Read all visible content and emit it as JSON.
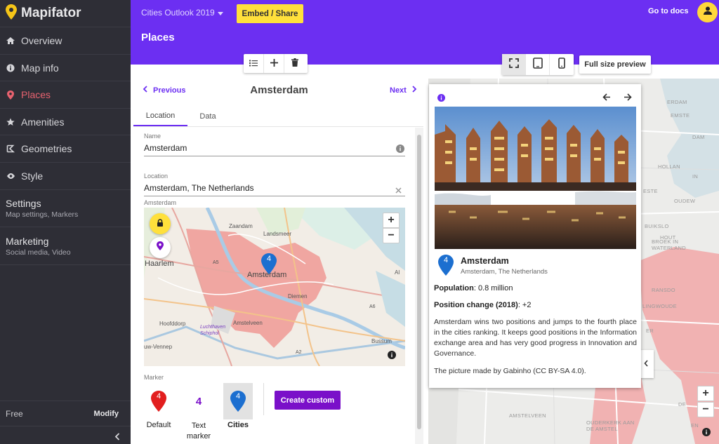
{
  "sidebar": {
    "brand": "Mapifator",
    "items": [
      {
        "label": "Overview",
        "icon": "home-icon"
      },
      {
        "label": "Map info",
        "icon": "info-icon"
      },
      {
        "label": "Places",
        "icon": "map-pin-icon",
        "active": true
      },
      {
        "label": "Amenities",
        "icon": "star-icon"
      },
      {
        "label": "Geometries",
        "icon": "geometry-icon"
      },
      {
        "label": "Style",
        "icon": "eye-icon"
      }
    ],
    "settings": {
      "title": "Settings",
      "subtitle": "Map settings, Markers"
    },
    "marketing": {
      "title": "Marketing",
      "subtitle": "Social media, Video"
    },
    "plan": "Free",
    "modify": "Modify"
  },
  "header": {
    "project": "Cities Outlook 2019",
    "embed": "Embed / Share",
    "docs": "Go to docs",
    "section": "Places"
  },
  "place": {
    "previous": "Previous",
    "next": "Next",
    "title": "Amsterdam",
    "tabs": [
      "Location",
      "Data"
    ],
    "name_label": "Name",
    "name_value": "Amsterdam",
    "location_label": "Location",
    "location_value": "Amsterdam, The Netherlands",
    "map_caption": "Amsterdam",
    "marker_label": "Marker",
    "marker_number": "4",
    "markers": [
      "Default",
      "Text marker",
      "Cities"
    ],
    "create_custom": "Create custom"
  },
  "minimap_labels": {
    "city": "Amsterdam",
    "haarlem": "Haarlem",
    "zaandam": "Zaandam",
    "landsmeer": "Landsmeer",
    "hoofddorp": "Hoofddorp",
    "amstelveen": "Amstelveen",
    "diemen": "Diemen",
    "schiphol": "Luchthaven Schiphol",
    "bussum": "Bussum",
    "venneper": "uw-Vennep",
    "almere": "Al",
    "a5": "A5",
    "a6": "A6",
    "a2": "A2"
  },
  "preview": {
    "button": "Full size preview",
    "title": "Amsterdam",
    "subtitle": "Amsterdam, The Netherlands",
    "population_label": "Population",
    "population_value": ": 0.8 million",
    "change_label": "Position change (2018)",
    "change_value": ": +2",
    "description": "Amsterdam wins two positions and jumps to the fourth place in the cities ranking. It keeps good positions in the Information exchange area and has very good progress in Innovation and Governance.",
    "credit": "The picture made by Gabinho (CC BY-SA 4.0).",
    "map_labels": [
      "ERDAM",
      "EMSTE",
      "DAM",
      "HOLLAN",
      "IN",
      "ESTE",
      "OUDEW",
      "BUIKSLO",
      "HOUT",
      "BROEK IN WATERLAND",
      "RANSDO",
      "LINGWOUDE",
      "ER",
      "AMSTELVEEN",
      "OUDERKERK AAN DE AMSTEL",
      "DE",
      "EN"
    ]
  },
  "colors": {
    "accent": "#6c2ff2",
    "yellow": "#ffe03b",
    "sidebar": "#2e2e36",
    "active": "#e8626f",
    "purple_btn": "#7a10c9"
  }
}
